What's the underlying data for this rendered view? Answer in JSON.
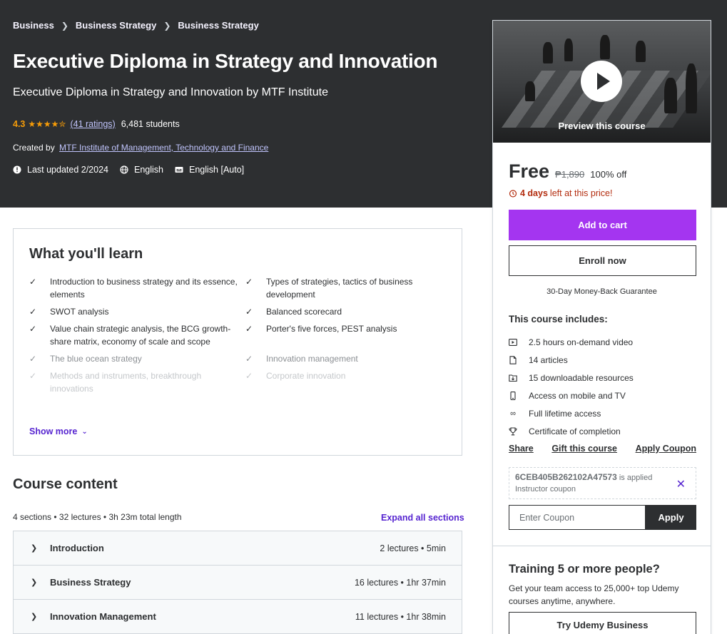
{
  "breadcrumb": [
    "Business",
    "Business Strategy",
    "Business Strategy"
  ],
  "course": {
    "title": "Executive Diploma in Strategy and Innovation",
    "subtitle": "Executive Diploma in Strategy and Innovation by MTF Institute",
    "rating": "4.3",
    "ratings_count": "(41 ratings)",
    "students": "6,481 students",
    "created_label": "Created by",
    "instructor": "MTF Institute of Management, Technology and Finance",
    "last_updated": "Last updated 2/2024",
    "language": "English",
    "captions": "English [Auto]"
  },
  "card": {
    "preview_label": "Preview this course",
    "price": "Free",
    "original_price": "₱1,890",
    "discount": "100% off",
    "timer_bold": "4 days",
    "timer_rest": "left at this price!",
    "add_to_cart": "Add to cart",
    "enroll_now": "Enroll now",
    "guarantee": "30-Day Money-Back Guarantee",
    "includes_title": "This course includes:",
    "includes": [
      {
        "icon": "video-icon",
        "text": "2.5 hours on-demand video"
      },
      {
        "icon": "article-icon",
        "text": "14 articles"
      },
      {
        "icon": "download-icon",
        "text": "15 downloadable resources"
      },
      {
        "icon": "mobile-icon",
        "text": "Access on mobile and TV"
      },
      {
        "icon": "infinity-icon",
        "text": "Full lifetime access"
      },
      {
        "icon": "trophy-icon",
        "text": "Certificate of completion"
      }
    ],
    "links": {
      "share": "Share",
      "gift": "Gift this course",
      "apply_coupon": "Apply Coupon"
    },
    "coupon_code": "6CEB405B262102A47573",
    "coupon_applied": "is applied",
    "coupon_type": "Instructor coupon",
    "coupon_placeholder": "Enter Coupon",
    "coupon_apply": "Apply",
    "training_title": "Training 5 or more people?",
    "training_desc": "Get your team access to 25,000+ top Udemy courses anytime, anywhere.",
    "try_business": "Try Udemy Business"
  },
  "learn": {
    "title": "What you'll learn",
    "items": [
      "Introduction to business strategy and its essence, elements",
      "Types of strategies, tactics of business development",
      "SWOT analysis",
      "Balanced scorecard",
      "Value chain strategic analysis, the BCG growth-share matrix, economy of scale and scope",
      "Porter's five forces, PEST analysis",
      "The blue ocean strategy",
      "Innovation management",
      "Methods and instruments, breakthrough innovations",
      "Corporate innovation"
    ],
    "show_more": "Show more"
  },
  "content": {
    "title": "Course content",
    "summary": "4 sections • 32 lectures • 3h 23m total length",
    "expand_all": "Expand all sections",
    "sections": [
      {
        "name": "Introduction",
        "info": "2 lectures • 5min"
      },
      {
        "name": "Business Strategy",
        "info": "16 lectures • 1hr 37min"
      },
      {
        "name": "Innovation Management",
        "info": "11 lectures • 1hr 38min"
      }
    ]
  },
  "colors": {
    "hero_bg": "#2d2f31",
    "accent_purple": "#a435f0",
    "link_purple": "#5624d0",
    "star": "#f69c08",
    "timer_red": "#b32d0f"
  }
}
